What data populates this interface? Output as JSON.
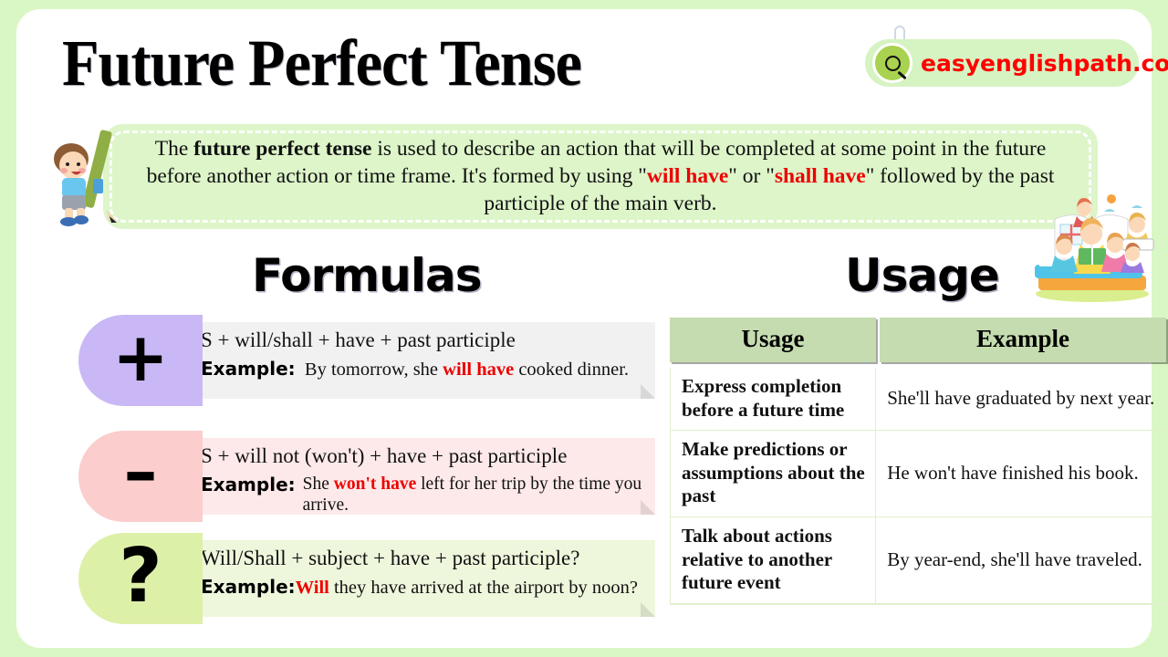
{
  "header": {
    "title": "Future Perfect Tense",
    "brand_text": "easyenglishpath.com",
    "brand_icon": "search-icon"
  },
  "description": {
    "part1": "The ",
    "bold1": "future perfect tense",
    "part2": " is used to describe an action that will be completed at some point in the future before another action or time frame. It's formed by using \"",
    "red1": "will have",
    "part3": "\" or \"",
    "red2": "shall have",
    "part4": "\" followed by the past participle of the main verb."
  },
  "sections": {
    "formulas_heading": "Formulas",
    "usage_heading": "Usage"
  },
  "formulas": [
    {
      "sign": "+",
      "formula": "S + will/shall + have + past participle",
      "example_label": "Example:",
      "example_pre": "By tomorrow, she ",
      "example_red": "will have",
      "example_post": " cooked dinner."
    },
    {
      "sign": "–",
      "formula": "S + will not (won't) + have + past participle",
      "example_label": "Example:",
      "example_pre": "She ",
      "example_red": "won't have",
      "example_post": " left for her trip by the time you arrive."
    },
    {
      "sign": "?",
      "formula": "Will/Shall + subject + have + past participle?",
      "example_label": "Example:",
      "example_pre": "",
      "example_red": "Will",
      "example_post": " they have arrived at the airport by noon?"
    }
  ],
  "usage_table": {
    "columns": [
      "Usage",
      "Example"
    ],
    "rows": [
      {
        "usage": "Express completion before a future time",
        "example": "She'll have graduated by next year."
      },
      {
        "usage": "Make predictions or assumptions about the past",
        "example": "He won't have finished his book."
      },
      {
        "usage": "Talk about actions relative to another future event",
        "example": "By year-end, she'll have traveled."
      }
    ]
  },
  "colors": {
    "page_background": "#d9f7c4",
    "card": "#ffffff",
    "description_box": "#ddf5c9",
    "accent_red": "#ee0000",
    "positive_badge": "#c9b8f5",
    "negative_badge": "#fbcdcd",
    "question_badge": "#ddf0a8",
    "table_header": "#c5dcb0",
    "brand_pill": "#d6f3c2",
    "logo_circle": "#a8d24f"
  }
}
